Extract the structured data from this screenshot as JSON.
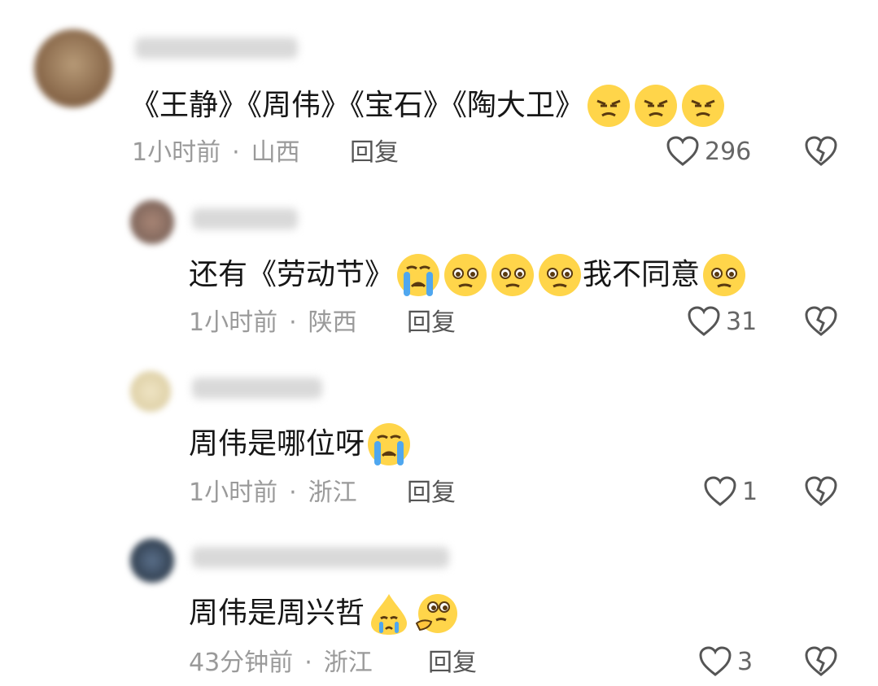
{
  "comments": [
    {
      "text": "《王静》《周伟》《宝石》《陶大卫》",
      "text_after": "",
      "emojis": [
        "pouting-face",
        "pouting-face",
        "pouting-face"
      ],
      "time": "1小时前",
      "location": "山西",
      "reply_label": "回复",
      "likes": "296"
    },
    {
      "text": "还有《劳动节》",
      "text_after": "我不同意",
      "emojis": [
        "crying-face",
        "pleading-face",
        "pleading-face",
        "pleading-face"
      ],
      "emojis_after": [
        "pleading-face"
      ],
      "time": "1小时前",
      "location": "陕西",
      "reply_label": "回复",
      "likes": "31"
    },
    {
      "text": "周伟是哪位呀",
      "emojis": [
        "crying-face"
      ],
      "time": "1小时前",
      "location": "浙江",
      "reply_label": "回复",
      "likes": "1"
    },
    {
      "text": "周伟是周兴哲",
      "emojis": [
        "crying-drop",
        "thinking-face"
      ],
      "time": "43分钟前",
      "location": "浙江",
      "reply_label": "回复",
      "likes": "3"
    }
  ],
  "separator": "·",
  "colors": {
    "meta": "#9a9a9a",
    "emoji": "#FFD54A"
  }
}
